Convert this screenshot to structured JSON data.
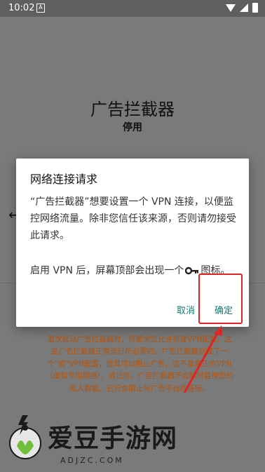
{
  "status_bar": {
    "time": "10:02",
    "notification_icon": "notification-icon"
  },
  "app": {
    "title": "广告拦截器",
    "status": "停用",
    "notice": "首次启动广告拦截器时，将要求您允许创建VPN配置。这是广告拦截器正常运行所必需的。广告拦截器创建了一个\"假\"VPN配置，使其可以阻止广告。这不是真正的VPN（虚拟专用网络）。请记住，广告拦截器不会随时监视您的私人数据。它只会阻止与广告平台的连接。"
  },
  "dialog": {
    "title": "网络连接请求",
    "message1": "“广告拦截器”想要设置一个 VPN 连接，以便监控网络流量。除非您信任该来源，否则请勿接受此请求。",
    "message2_before": "启用 VPN 后，屏幕顶部会出现一个",
    "message2_after": "图标。",
    "cancel_label": "取消",
    "ok_label": "确定"
  },
  "watermark": {
    "text": "爱豆手游网",
    "sub": "ADJZC.COM"
  },
  "colors": {
    "accent": "#157a6e",
    "highlight": "#e02424",
    "notice": "#b45309"
  }
}
